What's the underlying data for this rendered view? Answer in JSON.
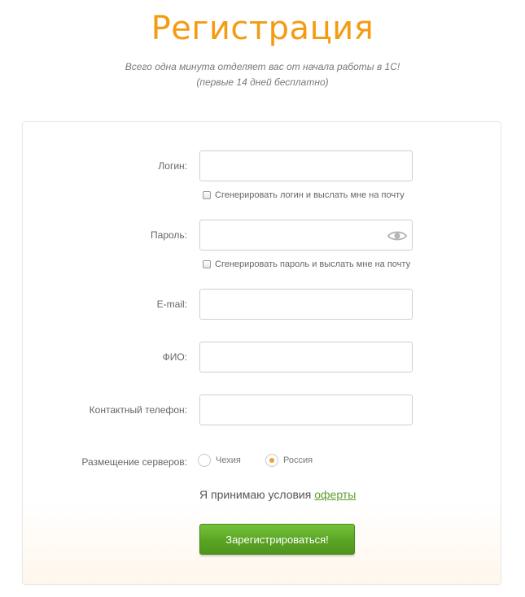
{
  "header": {
    "title": "Регистрация",
    "subtitle_line1": "Всего одна минута отделяет вас от начала работы в 1С!",
    "subtitle_line2": "(первые 14 дней бесплатно)"
  },
  "form": {
    "login": {
      "label": "Логин:",
      "value": "",
      "checkbox_label": "Сгенерировать логин и выслать мне на почту",
      "checkbox_checked": false
    },
    "password": {
      "label": "Пароль:",
      "value": "",
      "checkbox_label": "Сгенерировать пароль и выслать мне на почту",
      "checkbox_checked": false,
      "toggle_icon": "eye-icon"
    },
    "email": {
      "label": "E-mail:",
      "value": ""
    },
    "fio": {
      "label": "ФИО:",
      "value": ""
    },
    "phone": {
      "label": "Контактный телефон:",
      "value": ""
    },
    "server_location": {
      "label": "Размещение серверов:",
      "options": [
        {
          "label": "Чехия",
          "checked": false
        },
        {
          "label": "Россия",
          "checked": true
        }
      ]
    },
    "terms": {
      "text": "Я принимаю условия",
      "link_text": "оферты"
    },
    "submit_label": "Зарегистрироваться!"
  },
  "colors": {
    "title": "#f39c12",
    "link": "#5aa02c",
    "button": "#5aa424",
    "radio_dot": "#f0a030"
  }
}
